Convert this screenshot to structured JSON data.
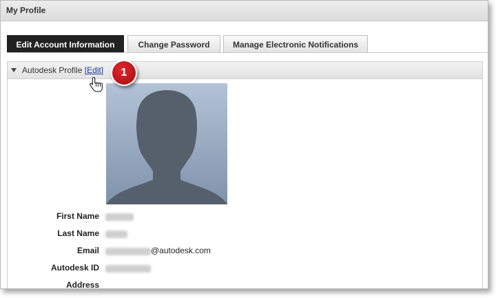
{
  "window": {
    "title": "My Profile"
  },
  "tabs": [
    {
      "label": "Edit Account Information",
      "active": true
    },
    {
      "label": "Change Password",
      "active": false
    },
    {
      "label": "Manage Electronic Notifications",
      "active": false
    }
  ],
  "profile_section": {
    "title": "Autodesk Profile",
    "bracket_open": "[",
    "edit_label": "Edit",
    "bracket_close": "]"
  },
  "callout": {
    "number": "1",
    "color": "#cc1e24"
  },
  "fields": {
    "first_name_label": "First Name",
    "last_name_label": "Last Name",
    "email_label": "Email",
    "email_domain": "@autodesk.com",
    "autodesk_id_label": "Autodesk ID",
    "address_label": "Address"
  },
  "icons": {
    "collapse": "triangle-down-icon",
    "pointer": "hand-pointer-icon",
    "avatar": "user-silhouette"
  }
}
